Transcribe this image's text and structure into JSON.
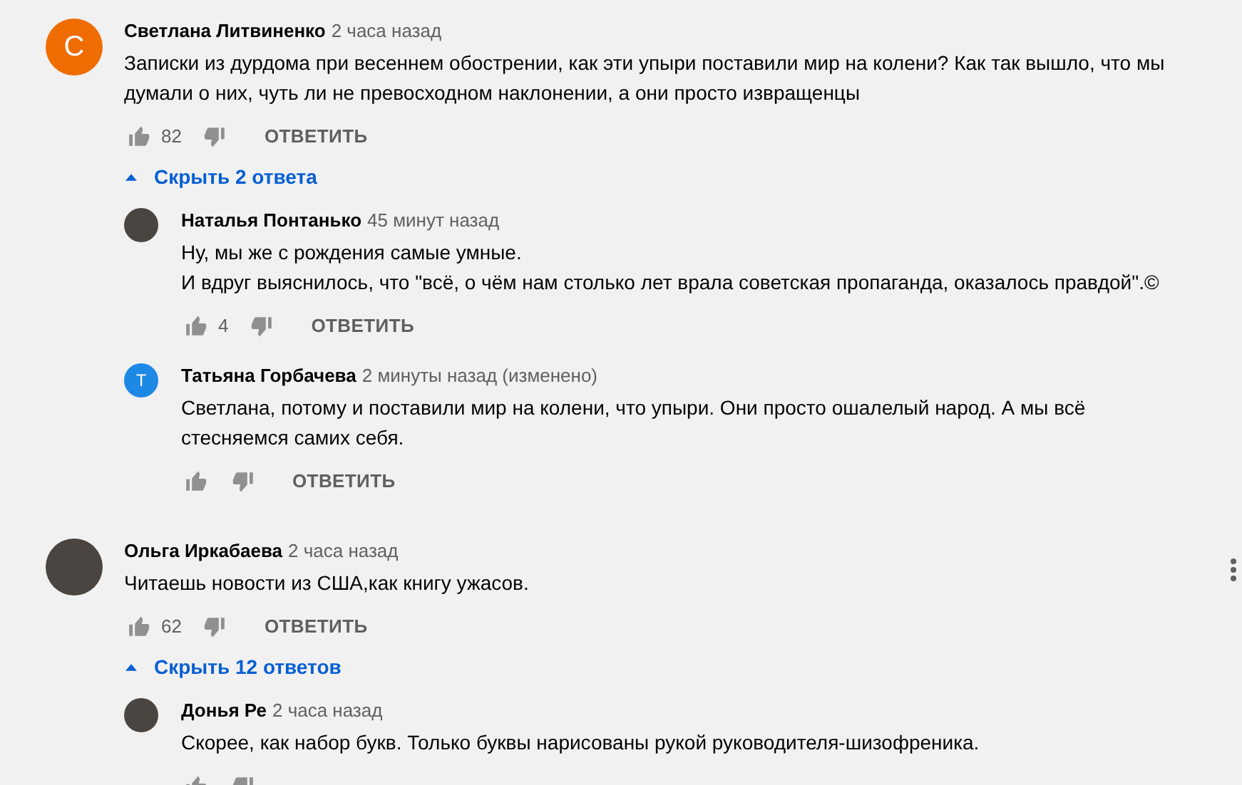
{
  "comments": [
    {
      "author": "Светлана Литвиненко",
      "time": "2 часа назад",
      "avatar": {
        "kind": "letter",
        "letter": "С",
        "color": "#ef6c00"
      },
      "text": "Записки из дурдома при весеннем обострении, как эти упыри поставили мир на колени? Как так вышло, что мы\nдумали о них, чуть ли не превосходном наклонении, а они просто извращенцы",
      "likes": "82",
      "reply_button": "ОТВЕТИТЬ",
      "menu_shown": false,
      "replies_toggle": "Скрыть 2 ответа",
      "replies": [
        {
          "author": "Наталья Понтанько",
          "time": "45 минут назад",
          "avatar": {
            "kind": "photo"
          },
          "text": "Ну, мы же с рождения самые умные.\nИ вдруг выяснилось, что \"всё, о чём нам столько лет врала советская пропаганда, оказалось правдой\".©",
          "likes": "4",
          "reply_button": "ОТВЕТИТЬ"
        },
        {
          "author": "Татьяна Горбачева",
          "time": "2 минуты назад (изменено)",
          "avatar": {
            "kind": "letter",
            "letter": "Т",
            "color": "#1e88e5"
          },
          "text": "Светлана, потому и поставили мир на колени, что упыри. Они просто ошалелый народ. А мы всё\nстесняемся самих себя.",
          "reply_button": "ОТВЕТИТЬ"
        }
      ]
    },
    {
      "author": "Ольга Иркабаева",
      "time": "2 часа назад",
      "avatar": {
        "kind": "photo"
      },
      "text": "Читаешь новости из США,как книгу ужасов.",
      "likes": "62",
      "reply_button": "ОТВЕТИТЬ",
      "menu_shown": true,
      "replies_toggle": "Скрыть 12 ответов",
      "replies": [
        {
          "author": "Донья Ре",
          "time": "2 часа назад",
          "avatar": {
            "kind": "photo"
          },
          "text": "Скорее, как набор букв. Только буквы нарисованы рукой руководителя-шизофреника."
        }
      ]
    }
  ]
}
